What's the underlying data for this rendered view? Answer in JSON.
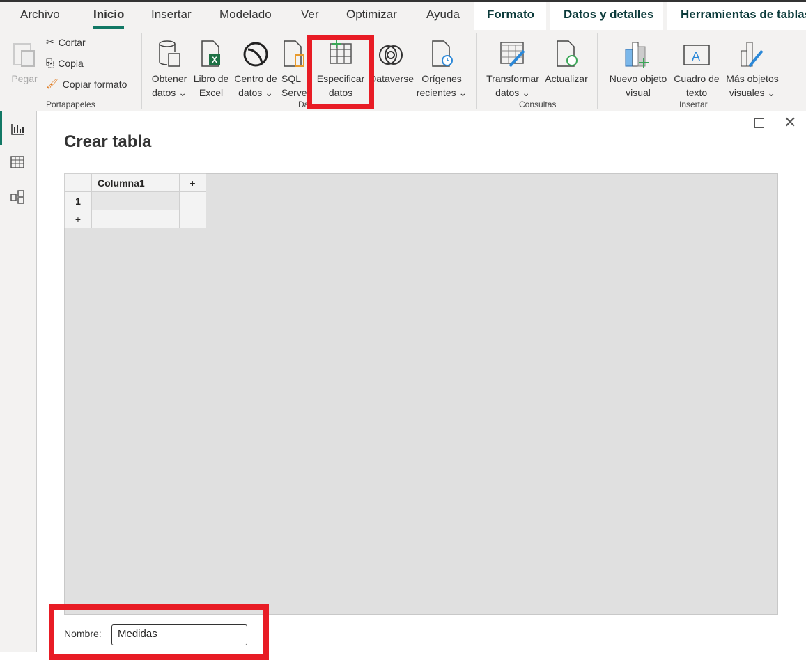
{
  "menu_tabs": [
    "Archivo",
    "Inicio",
    "Insertar",
    "Modelado",
    "Ver",
    "Optimizar",
    "Ayuda"
  ],
  "context_tabs": [
    "Formato",
    "Datos y detalles",
    "Herramientas de tablas"
  ],
  "clipboard": {
    "paste": "Pegar",
    "cut": "Cortar",
    "copy": "Copia",
    "format_painter": "Copiar formato",
    "group": "Portapapeles"
  },
  "data_group": {
    "get_data": [
      "Obtener",
      "datos"
    ],
    "excel": [
      "Libro de",
      "Excel"
    ],
    "hub": [
      "Centro de",
      "datos"
    ],
    "sql": [
      "SQL",
      "Serve"
    ],
    "enter_data": [
      "Especificar",
      "datos"
    ],
    "dataverse": "Dataverse",
    "recent": [
      "Orígenes",
      "recientes"
    ],
    "group": "Da"
  },
  "queries": {
    "transform": [
      "Transformar",
      "datos"
    ],
    "refresh": "Actualizar",
    "group": "Consultas"
  },
  "insert": {
    "new_visual": [
      "Nuevo objeto",
      "visual"
    ],
    "textbox": [
      "Cuadro de",
      "texto"
    ],
    "more_visuals": [
      "Más objetos",
      "visuales"
    ],
    "group": "Insertar"
  },
  "dialog": {
    "title": "Crear tabla",
    "column_header": "Columna1",
    "add_column": "+",
    "row_number": "1",
    "add_row": "+",
    "name_label": "Nombre:",
    "name_value": "Medidas"
  },
  "colors": {
    "accent": "#117865",
    "highlight": "#e81c25"
  }
}
